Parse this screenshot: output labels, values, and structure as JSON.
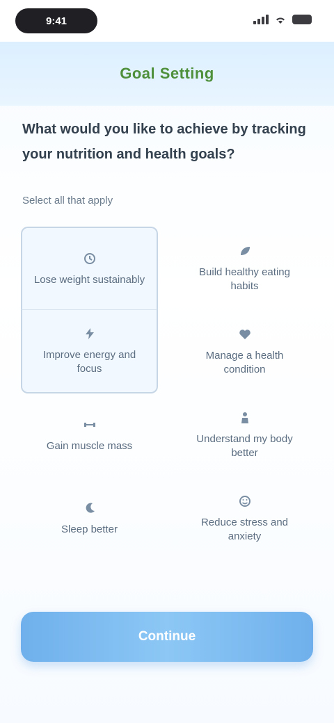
{
  "status_bar": {
    "time": "9:41"
  },
  "header": {
    "title": "Goal Setting"
  },
  "question": "What would you like to achieve by tracking your nutrition and health goals?",
  "hint": "Select all that apply",
  "options": [
    {
      "label": "Lose weight sustainably",
      "icon": "scale-icon"
    },
    {
      "label": "Build healthy eating habits",
      "icon": "leaf-icon"
    },
    {
      "label": "Improve energy and focus",
      "icon": "bolt-icon"
    },
    {
      "label": "Manage a health condition",
      "icon": "heart-icon"
    },
    {
      "label": "Gain muscle mass",
      "icon": "dumbbell-icon"
    },
    {
      "label": "Understand my body better",
      "icon": "body-icon"
    },
    {
      "label": "Sleep better",
      "icon": "moon-icon"
    },
    {
      "label": "Reduce stress and anxiety",
      "icon": "smile-icon"
    }
  ],
  "cta_label": "Continue",
  "colors": {
    "accent": "#7ab8ef",
    "header_bg": "#dcefff",
    "title_green": "#4d8f3a"
  }
}
